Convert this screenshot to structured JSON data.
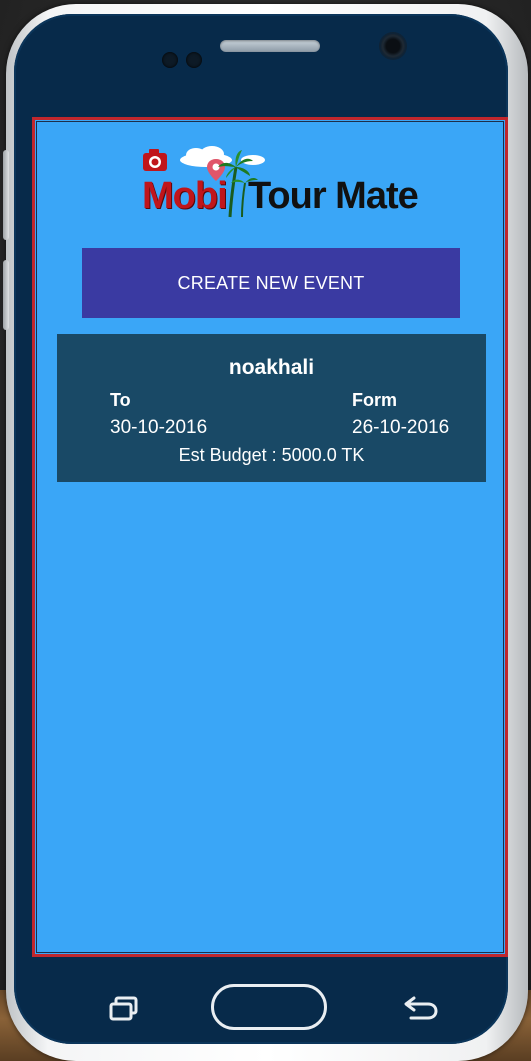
{
  "app": {
    "logo_part1": "Mobi",
    "logo_part2": "Tour Mate"
  },
  "actions": {
    "create_event_label": "CREATE NEW EVENT"
  },
  "events": [
    {
      "name": "noakhali",
      "to_label": "To",
      "to_date": "30-10-2016",
      "from_label": "Form",
      "from_date": "26-10-2016",
      "budget": "Est Budget : 5000.0 TK"
    }
  ],
  "nav": {
    "recent_icon": "recent-apps-icon",
    "home_icon": "home-button",
    "back_icon": "back-arrow-icon"
  },
  "colors": {
    "screen_bg": "#3aa6f7",
    "button_bg": "#3a3aa2",
    "card_bg": "#194966",
    "logo_red": "#c0151b",
    "phone_body": "#072a4a"
  }
}
